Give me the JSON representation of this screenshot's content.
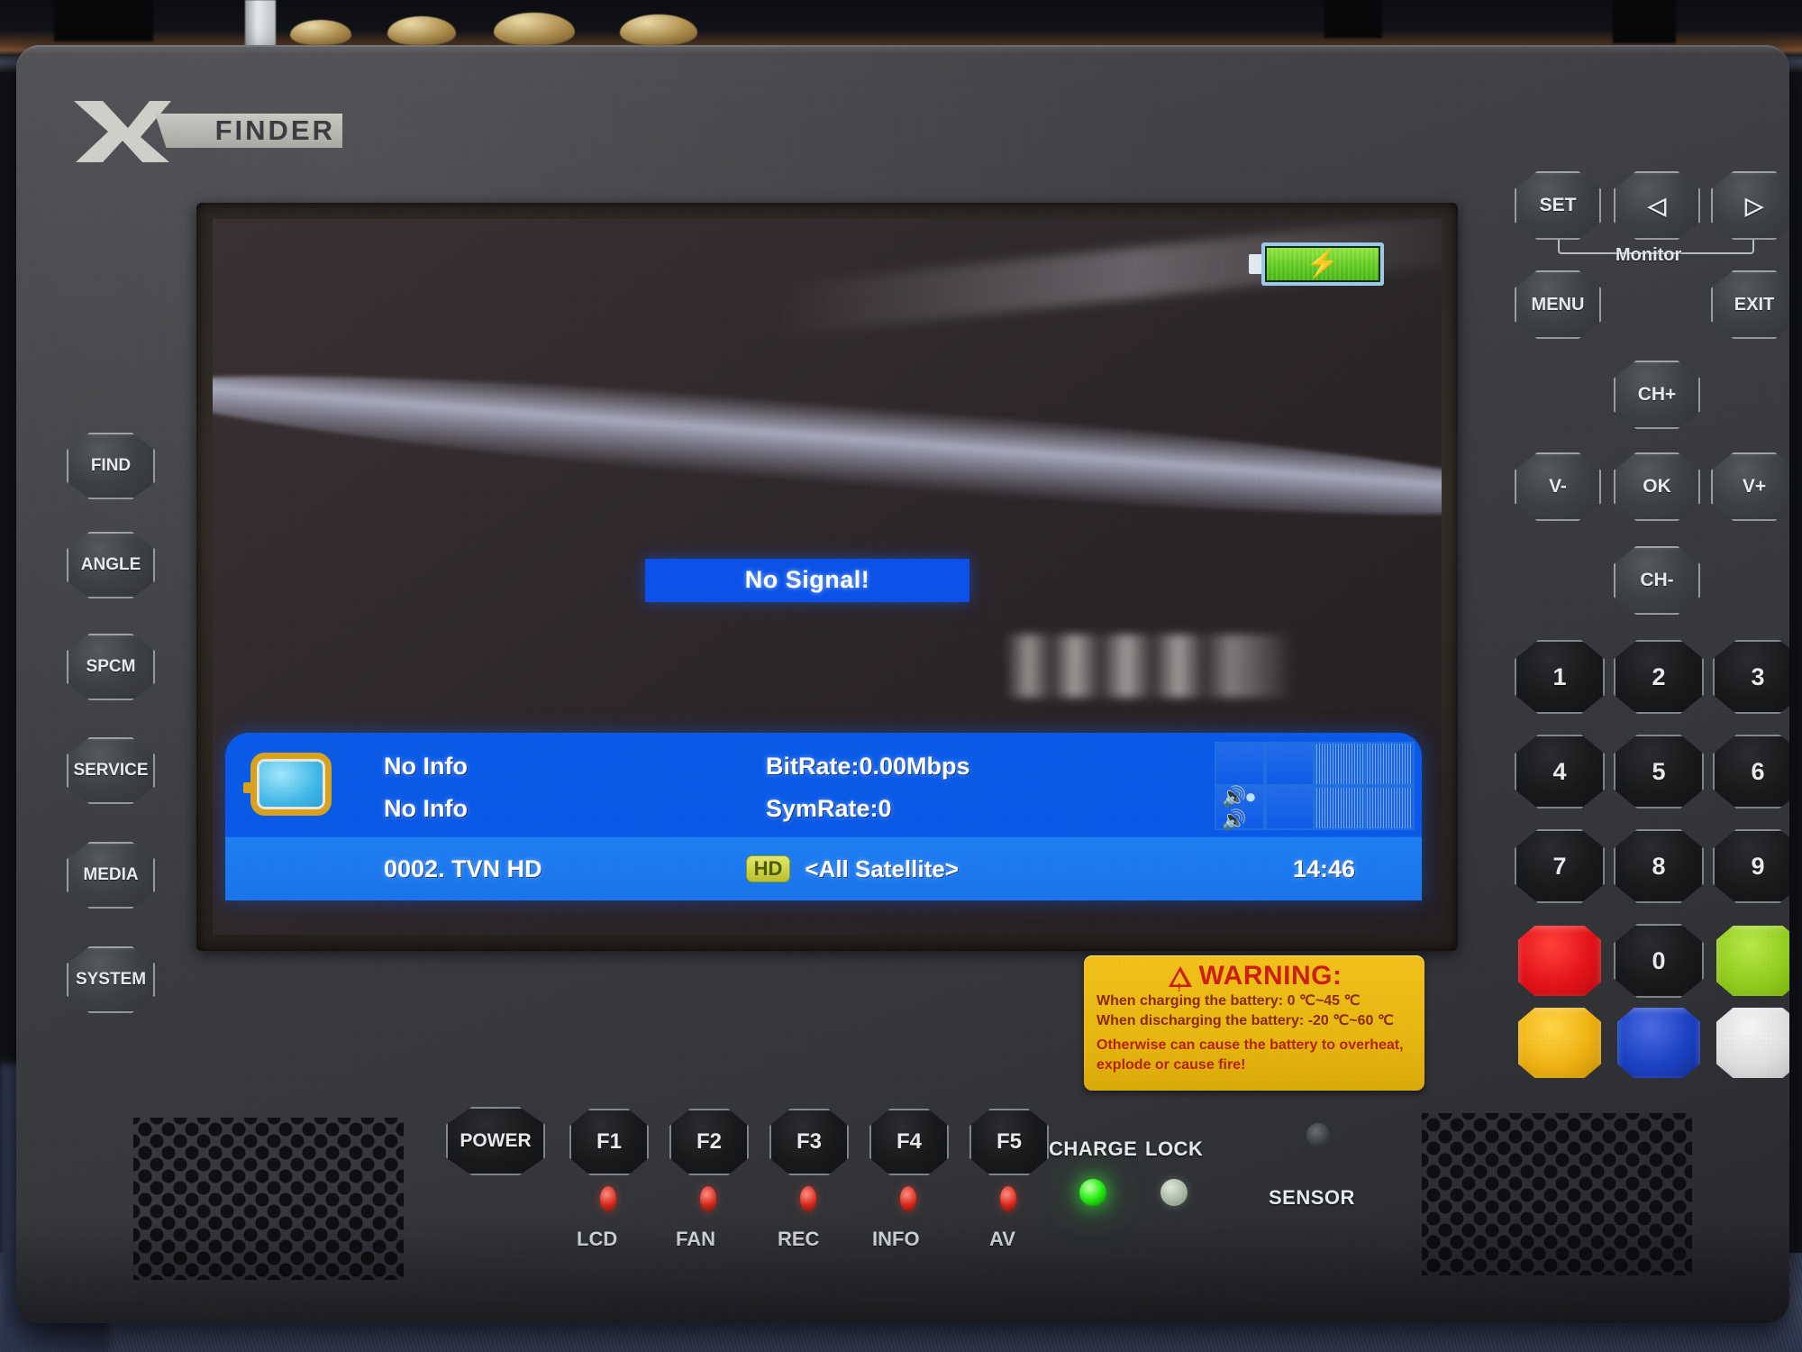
{
  "device": {
    "brand_x": "X",
    "brand_finder": "FINDER"
  },
  "screen": {
    "battery": {
      "icon": "battery-charging-icon",
      "state": "charging"
    },
    "banner": {
      "text": "No Signal!"
    },
    "osd": {
      "tv_icon": "tv-monitor-icon",
      "line1": "No Info",
      "line2": "No Info",
      "bitrate": "BitRate:0.00Mbps",
      "symrate": "SymRate:0",
      "stereo_icon": "stereo-audio-icon",
      "channel": "0002.  TVN HD",
      "hd_badge": "HD",
      "satellite": "<All Satellite>",
      "clock": "14:46"
    }
  },
  "left_buttons": [
    {
      "label": "FIND"
    },
    {
      "label": "ANGLE"
    },
    {
      "label": "SPCM"
    },
    {
      "label": "SERVICE"
    },
    {
      "label": "MEDIA"
    },
    {
      "label": "SYSTEM"
    }
  ],
  "nav_cluster": {
    "set": "SET",
    "left_arrow": "◁",
    "right_arrow": "▷",
    "monitor_label": "Monitor",
    "menu": "MENU",
    "exit": "EXIT",
    "ch_up": "CH+",
    "vol_down": "V-",
    "ok": "OK",
    "vol_up": "V+",
    "ch_down": "CH-"
  },
  "keypad": {
    "digits": [
      "1",
      "2",
      "3",
      "4",
      "5",
      "6",
      "7",
      "8",
      "9"
    ],
    "zero": "0",
    "colors": {
      "red": "#e3131a",
      "green": "#92cc1c",
      "yellow": "#efb212",
      "blue": "#1b41c4",
      "white": "#dcdedd"
    }
  },
  "bottom_row": {
    "power": "POWER",
    "function_keys": [
      "F1",
      "F2",
      "F3",
      "F4",
      "F5"
    ],
    "led_labels": [
      "LCD",
      "FAN",
      "REC",
      "INFO",
      "AV"
    ],
    "led_color": "#d6271a"
  },
  "indicators": {
    "charge_label": "CHARGE",
    "lock_label": "LOCK",
    "sensor_label": "SENSOR",
    "charge_state": "on",
    "lock_state": "off",
    "charge_color": "#2ff21a"
  },
  "warning": {
    "title": "WARNING:",
    "line1": "When charging the battery: 0 ℃~45 ℃",
    "line2": "When discharging the battery: -20 ℃~60 ℃",
    "line3": "Otherwise can cause the battery to overheat,",
    "line4": "explode or cause fire!",
    "title_color": "#cc1f10",
    "bg_color": "#ecba14"
  }
}
